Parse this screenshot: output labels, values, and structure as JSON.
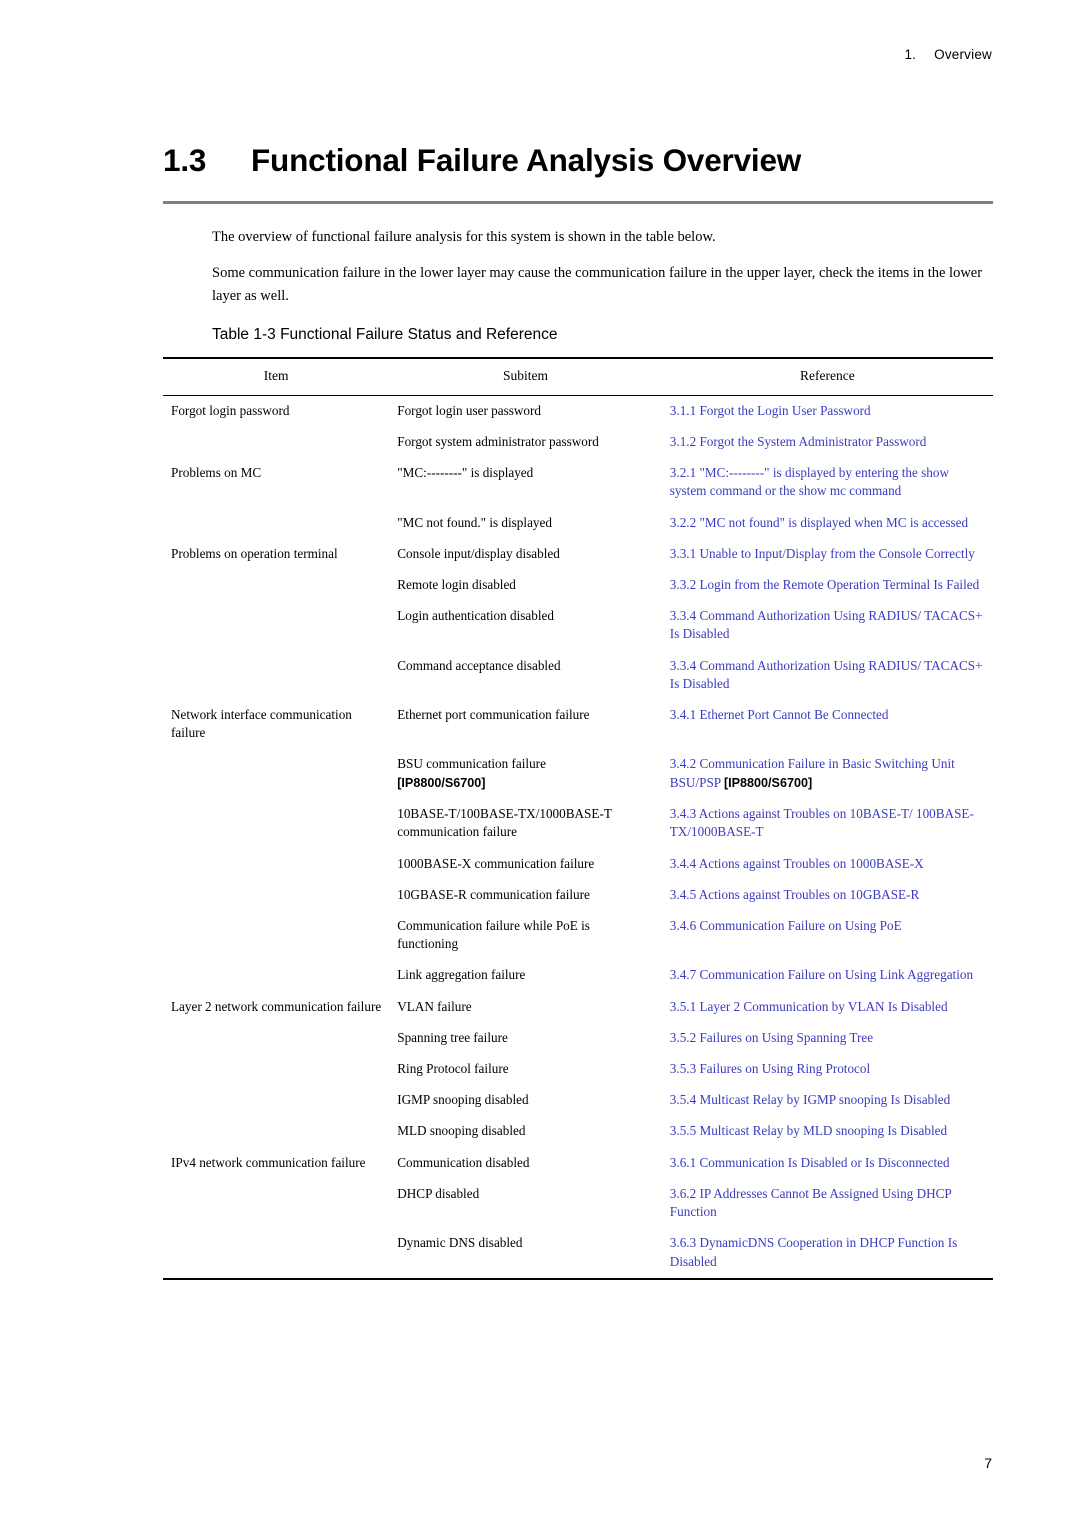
{
  "header": {
    "chapter_number": "1.",
    "chapter_label": "Overview"
  },
  "title": {
    "section_number": "1.3",
    "text": "Functional Failure Analysis Overview"
  },
  "intro": {
    "paragraph1": "The overview of functional failure analysis for this system is shown in the table below.",
    "paragraph2": "Some communication failure in the lower layer may cause the communication failure in the upper layer, check the items in the lower layer as well."
  },
  "table": {
    "caption": "Table 1-3 Functional Failure Status and Reference",
    "columns": [
      "Item",
      "Subitem",
      "Reference"
    ],
    "rows": [
      {
        "item": "Forgot login password",
        "subitem": "Forgot login user password",
        "reference": "3.1.1 Forgot the Login User Password"
      },
      {
        "item": "",
        "subitem": "Forgot system administrator password",
        "reference": "3.1.2 Forgot the System Administrator Password"
      },
      {
        "item": "Problems on MC",
        "subitem": "\"MC:--------\" is displayed",
        "reference": "3.2.1 \"MC:--------\" is displayed by entering the show system command or the show mc command"
      },
      {
        "item": "",
        "subitem": "\"MC not found.\" is displayed",
        "reference": "3.2.2 \"MC not found\" is displayed when MC is accessed"
      },
      {
        "item": "Problems on operation terminal",
        "subitem": "Console input/display disabled",
        "reference": "3.3.1 Unable to Input/Display from the Console Correctly"
      },
      {
        "item": "",
        "subitem": "Remote login disabled",
        "reference": "3.3.2 Login from the Remote Operation Terminal Is Failed"
      },
      {
        "item": "",
        "subitem": "Login authentication disabled",
        "reference": "3.3.4 Command Authorization Using RADIUS/ TACACS+ Is Disabled"
      },
      {
        "item": "",
        "subitem": "Command acceptance disabled",
        "reference": "3.3.4 Command Authorization Using RADIUS/ TACACS+ Is Disabled"
      },
      {
        "item": "Network interface communication failure",
        "subitem": "Ethernet port communication failure",
        "reference": "3.4.1 Ethernet Port Cannot Be Connected"
      },
      {
        "item": "",
        "subitem": "BSU communication failure",
        "subitem_note": "[IP8800/S6700]",
        "reference": "3.4.2 Communication Failure in Basic Switching Unit",
        "reference_note_link": "BSU/PSP",
        "reference_note": "[IP8800/S6700]"
      },
      {
        "item": "",
        "subitem": "10BASE-T/100BASE-TX/1000BASE-T communication failure",
        "reference": "3.4.3 Actions against Troubles on 10BASE-T/ 100BASE-TX/1000BASE-T"
      },
      {
        "item": "",
        "subitem": "1000BASE-X communication failure",
        "reference": "3.4.4 Actions against Troubles on 1000BASE-X"
      },
      {
        "item": "",
        "subitem": "10GBASE-R communication failure",
        "reference": "3.4.5 Actions against Troubles on 10GBASE-R"
      },
      {
        "item": "",
        "subitem": "Communication failure while PoE is functioning",
        "reference": "3.4.6 Communication Failure on Using PoE"
      },
      {
        "item": "",
        "subitem": "Link aggregation failure",
        "reference": "3.4.7 Communication Failure on Using Link Aggregation"
      },
      {
        "item": "Layer 2 network communication failure",
        "subitem": "VLAN failure",
        "reference": "3.5.1 Layer 2 Communication by VLAN Is Disabled"
      },
      {
        "item": "",
        "subitem": "Spanning tree failure",
        "reference": "3.5.2 Failures on Using Spanning Tree"
      },
      {
        "item": "",
        "subitem": "Ring Protocol failure",
        "reference": "3.5.3 Failures on Using Ring Protocol"
      },
      {
        "item": "",
        "subitem": "IGMP snooping disabled",
        "reference": "3.5.4 Multicast Relay by IGMP snooping Is Disabled"
      },
      {
        "item": "",
        "subitem": "MLD snooping disabled",
        "reference": "3.5.5 Multicast Relay by MLD snooping Is Disabled"
      },
      {
        "item": "IPv4 network communication failure",
        "subitem": "Communication disabled",
        "reference": "3.6.1 Communication Is Disabled or Is Disconnected"
      },
      {
        "item": "",
        "subitem": "DHCP disabled",
        "reference": "3.6.2 IP Addresses Cannot Be Assigned Using DHCP Function"
      },
      {
        "item": "",
        "subitem": "Dynamic DNS disabled",
        "reference": "3.6.3 DynamicDNS Cooperation in DHCP Function Is Disabled"
      }
    ]
  },
  "footer": {
    "page_number": "7"
  }
}
